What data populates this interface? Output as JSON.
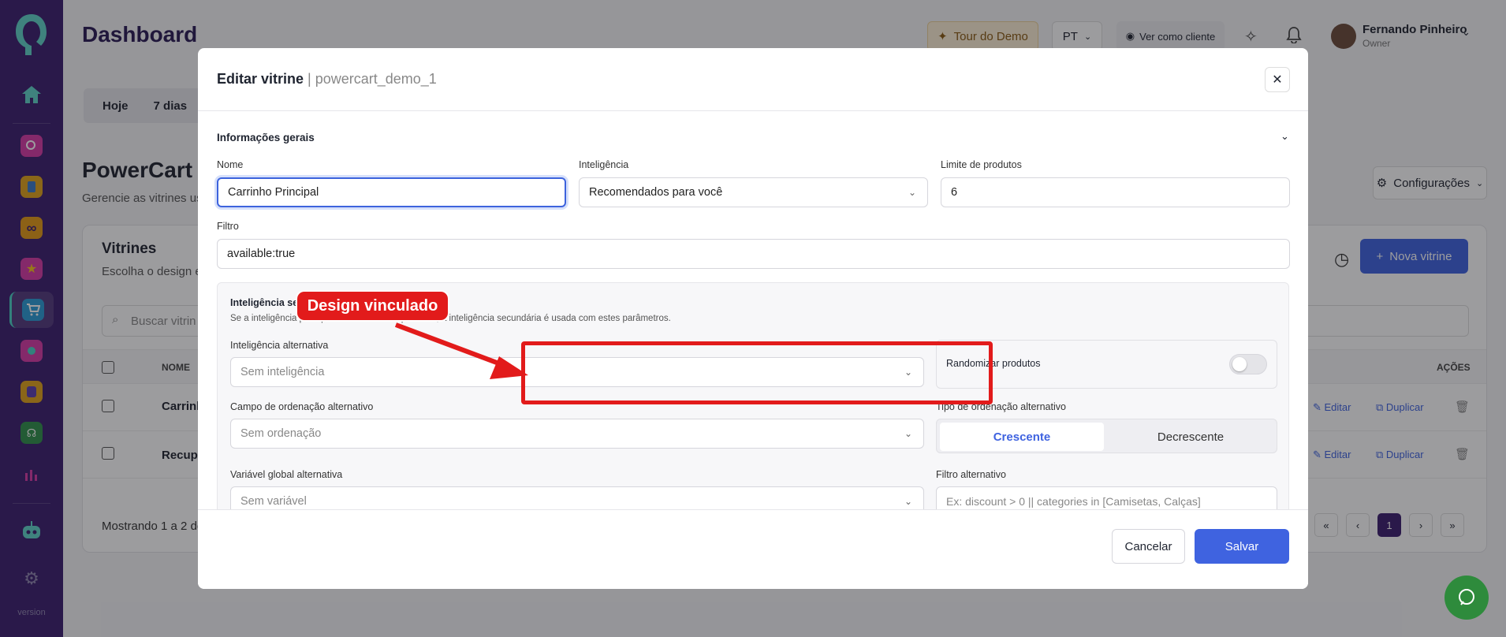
{
  "header": {
    "title": "Dashboard",
    "tour_label": "Tour do Demo",
    "lang": "PT",
    "view_as_client": "Ver como cliente",
    "user_name": "Fernando Pinheiro",
    "user_role": "Owner"
  },
  "sidebar": {
    "version": "version"
  },
  "period": {
    "today": "Hoje",
    "seven_days": "7 dias"
  },
  "page": {
    "title": "PowerCart",
    "subtitle": "Gerencie as vitrines us",
    "config_label": "Configurações"
  },
  "card": {
    "title": "Vitrines",
    "subtitle": "Escolha o design e",
    "new_label": "Nova vitrine",
    "search_placeholder": "Buscar vitrin",
    "col_name": "NOME",
    "col_actions": "AÇÕES",
    "rows": [
      {
        "name": "Carrinh",
        "edit": "Editar",
        "duplicate": "Duplicar"
      },
      {
        "name": "Recupe",
        "edit": "Editar",
        "duplicate": "Duplicar"
      }
    ],
    "footer_text": "Mostrando 1 a 2 de",
    "page_current": "1"
  },
  "modal": {
    "title": "Editar vitrine",
    "subtitle": "| powercart_demo_1",
    "section_title": "Informações gerais",
    "name_label": "Nome",
    "name_value": "Carrinho Principal",
    "intel_label": "Inteligência",
    "intel_value": "Recomendados para você",
    "limit_label": "Limite de produtos",
    "limit_value": "6",
    "filter_label": "Filtro",
    "filter_value": "available:true",
    "secondary": {
      "title": "Inteligência se",
      "desc_left": "Se a inteligência principal ",
      "desc_right": " produtos, a inteligência secundária é usada com estes parâmetros.",
      "alt_intel_label": "Inteligência alternativa",
      "alt_intel_placeholder": "Sem inteligência",
      "randomize_label": "Randomizar produtos",
      "alt_sort_field_label": "Campo de ordenação alternativo",
      "alt_sort_field_placeholder": "Sem ordenação",
      "alt_sort_type_label": "Tipo de ordenação alternativo",
      "asc": "Crescente",
      "desc": "Decrescente",
      "alt_global_var_label": "Variável global alternativa",
      "alt_global_var_placeholder": "Sem variável",
      "alt_filter_label": "Filtro alternativo",
      "alt_filter_placeholder": "Ex: discount > 0 || categories in [Camisetas, Calças]"
    },
    "cancel": "Cancelar",
    "save": "Salvar"
  },
  "annotation": {
    "callout": "Design vinculado"
  },
  "colors": {
    "sidebar": "#3c1e6e",
    "primary": "#3f63e0",
    "annotation": "#e21b1b"
  }
}
